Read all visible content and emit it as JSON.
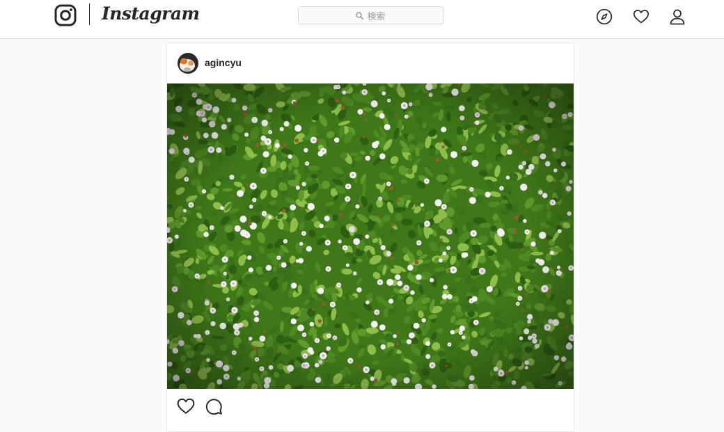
{
  "header": {
    "brand": "Instagram",
    "search_placeholder": "検索",
    "icons": [
      "instagram-logo-icon",
      "compass-icon",
      "heart-icon",
      "person-icon",
      "search-icon"
    ]
  },
  "post": {
    "username": "agincyu",
    "photo": {
      "subject": "white clover flowers in green leaves",
      "colors": {
        "leaf_dark": "#2d5e12",
        "leaf": "#4e8a22",
        "leaf_light": "#8fbd4a",
        "flower": "#f4f2f4"
      }
    },
    "action_icons": [
      "like-heart-icon",
      "comment-bubble-icon"
    ]
  },
  "theme": {
    "text": "#262626",
    "border": "#dbdbdb",
    "background": "#fafafa",
    "muted": "#999999"
  }
}
